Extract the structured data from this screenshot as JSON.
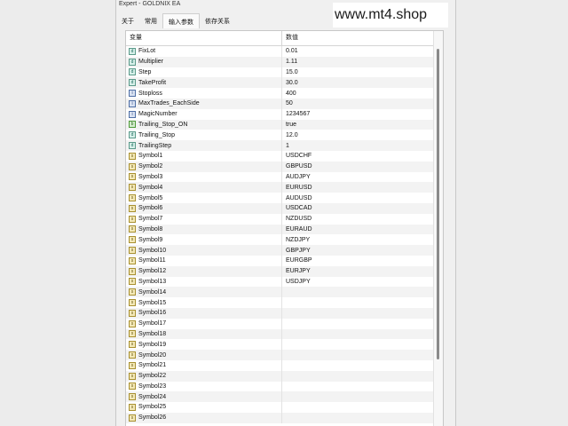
{
  "window": {
    "title": "Expert - GOLDNIX EA"
  },
  "tabs": [
    {
      "label": "关于"
    },
    {
      "label": "常用"
    },
    {
      "label": "输入参数"
    },
    {
      "label": "依存关系"
    }
  ],
  "watermark": "www.mt4.shop",
  "table": {
    "col_variable": "变量",
    "col_value": "数值",
    "rows": [
      {
        "name": "FixLot",
        "value": "0.01",
        "icon": "double-icon"
      },
      {
        "name": "Multiplier",
        "value": "1.11",
        "icon": "double-icon"
      },
      {
        "name": "Step",
        "value": "15.0",
        "icon": "double-icon"
      },
      {
        "name": "TakeProfit",
        "value": "30.0",
        "icon": "double-icon"
      },
      {
        "name": "Stoploss",
        "value": "400",
        "icon": "integer-icon"
      },
      {
        "name": "MaxTrades_EachSide",
        "value": "50",
        "icon": "integer-icon"
      },
      {
        "name": "MagicNumber",
        "value": "1234567",
        "icon": "integer-icon"
      },
      {
        "name": "Trailing_Stop_ON",
        "value": "true",
        "icon": "boolean-icon"
      },
      {
        "name": "Trailing_Stop",
        "value": "12.0",
        "icon": "double-icon"
      },
      {
        "name": "TrailingStep",
        "value": "1",
        "icon": "double-icon"
      },
      {
        "name": "Symbol1",
        "value": "USDCHF",
        "icon": "string-icon"
      },
      {
        "name": "Symbol2",
        "value": "GBPUSD",
        "icon": "string-icon"
      },
      {
        "name": "Symbol3",
        "value": "AUDJPY",
        "icon": "string-icon"
      },
      {
        "name": "Symbol4",
        "value": "EURUSD",
        "icon": "string-icon"
      },
      {
        "name": "Symbol5",
        "value": "AUDUSD",
        "icon": "string-icon"
      },
      {
        "name": "Symbol6",
        "value": "USDCAD",
        "icon": "string-icon"
      },
      {
        "name": "Symbol7",
        "value": "NZDUSD",
        "icon": "string-icon"
      },
      {
        "name": "Symbol8",
        "value": "EURAUD",
        "icon": "string-icon"
      },
      {
        "name": "Symbol9",
        "value": "NZDJPY",
        "icon": "string-icon"
      },
      {
        "name": "Symbol10",
        "value": "GBPJPY",
        "icon": "string-icon"
      },
      {
        "name": "Symbol11",
        "value": "EURGBP",
        "icon": "string-icon"
      },
      {
        "name": "Symbol12",
        "value": "EURJPY",
        "icon": "string-icon"
      },
      {
        "name": "Symbol13",
        "value": "USDJPY",
        "icon": "string-icon"
      },
      {
        "name": "Symbol14",
        "value": "",
        "icon": "string-icon"
      },
      {
        "name": "Symbol15",
        "value": "",
        "icon": "string-icon"
      },
      {
        "name": "Symbol16",
        "value": "",
        "icon": "string-icon"
      },
      {
        "name": "Symbol17",
        "value": "",
        "icon": "string-icon"
      },
      {
        "name": "Symbol18",
        "value": "",
        "icon": "string-icon"
      },
      {
        "name": "Symbol19",
        "value": "",
        "icon": "string-icon"
      },
      {
        "name": "Symbol20",
        "value": "",
        "icon": "string-icon"
      },
      {
        "name": "Symbol21",
        "value": "",
        "icon": "string-icon"
      },
      {
        "name": "Symbol22",
        "value": "",
        "icon": "string-icon"
      },
      {
        "name": "Symbol23",
        "value": "",
        "icon": "string-icon"
      },
      {
        "name": "Symbol24",
        "value": "",
        "icon": "string-icon"
      },
      {
        "name": "Symbol25",
        "value": "",
        "icon": "string-icon"
      },
      {
        "name": "Symbol26",
        "value": "",
        "icon": "string-icon"
      }
    ]
  }
}
